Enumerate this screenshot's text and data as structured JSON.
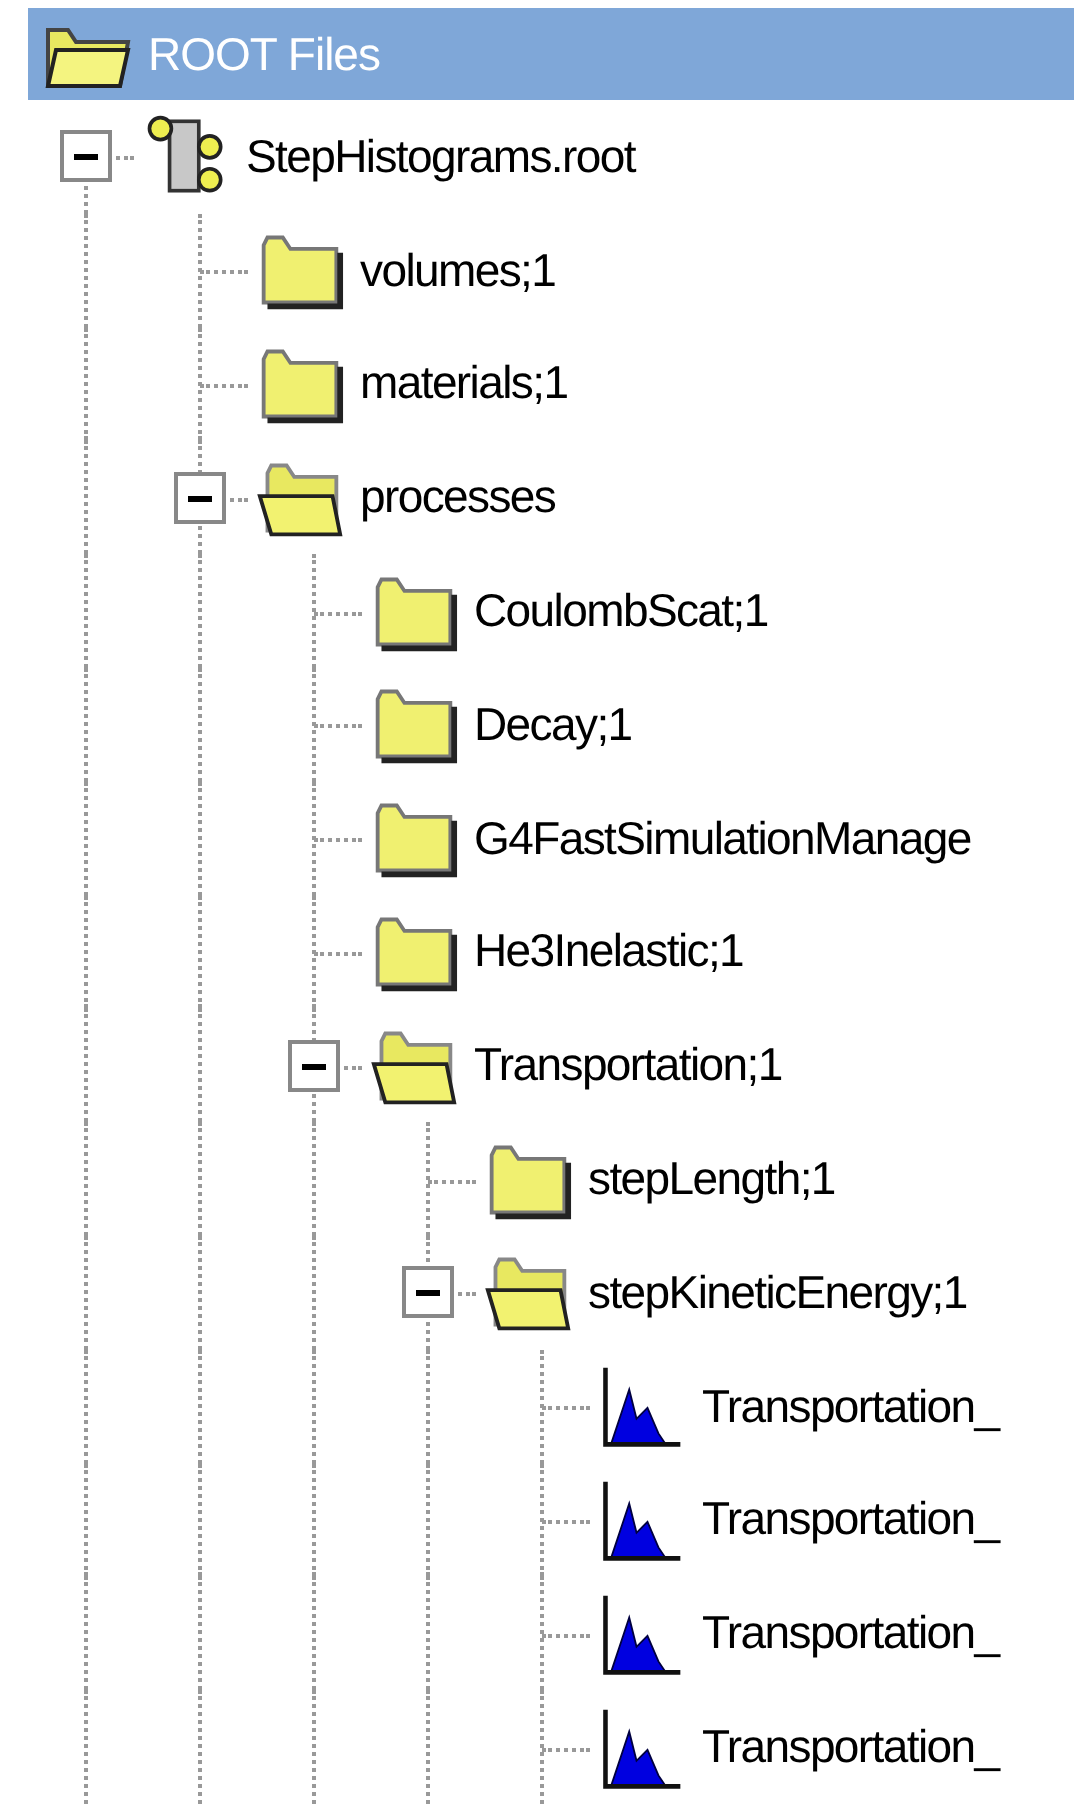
{
  "header": {
    "title": "ROOT Files",
    "selected": true
  },
  "tree": [
    {
      "label": "StepHistograms.root",
      "kind": "file",
      "expanded": true,
      "children": [
        {
          "label": "volumes;1",
          "kind": "folder"
        },
        {
          "label": "materials;1",
          "kind": "folder"
        },
        {
          "label": "processes",
          "kind": "folder",
          "expanded": true,
          "children": [
            {
              "label": "CoulombScat;1",
              "kind": "folder"
            },
            {
              "label": "Decay;1",
              "kind": "folder"
            },
            {
              "label": "G4FastSimulationManage",
              "kind": "folder"
            },
            {
              "label": "He3Inelastic;1",
              "kind": "folder"
            },
            {
              "label": "Transportation;1",
              "kind": "folder",
              "expanded": true,
              "children": [
                {
                  "label": "stepLength;1",
                  "kind": "folder"
                },
                {
                  "label": "stepKineticEnergy;1",
                  "kind": "folder",
                  "expanded": true,
                  "children": [
                    {
                      "label": "Transportation_",
                      "kind": "histogram"
                    },
                    {
                      "label": "Transportation_",
                      "kind": "histogram"
                    },
                    {
                      "label": "Transportation_",
                      "kind": "histogram"
                    },
                    {
                      "label": "Transportation_",
                      "kind": "histogram"
                    }
                  ]
                }
              ]
            }
          ]
        }
      ]
    }
  ]
}
